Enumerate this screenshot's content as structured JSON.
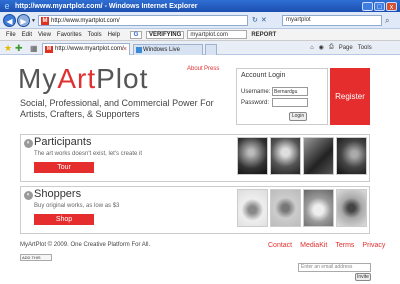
{
  "window": {
    "title": "http://www.myartplot.com/ - Windows Internet Explorer",
    "minimize": "_",
    "maximize": "□",
    "close": "x"
  },
  "addressbar": {
    "url": "http://www.myartplot.com/",
    "search_value": "myartplot"
  },
  "menubar": {
    "items": [
      "File",
      "Edit",
      "View",
      "Favorites",
      "Tools",
      "Help"
    ],
    "verifying_label": "VERIFYING",
    "verify_value": "myartplot.com",
    "report_label": "REPORT"
  },
  "tabs": [
    {
      "label": "http://www.myartplot.com/"
    },
    {
      "label": "Windows Live Hotmail"
    }
  ],
  "commandbar": {
    "page_label": "Page",
    "tools_label": "Tools"
  },
  "page": {
    "logo_my": "My",
    "logo_art": "Art",
    "logo_plot": "Plot",
    "nav": {
      "about": "About",
      "press": "Press"
    },
    "tagline": "Social, Professional, and Commercial Power For Artists, Crafters, & Supporters",
    "login": {
      "title": "Account Login",
      "username_label": "Username:",
      "username_value": "Bernardgu",
      "password_label": "Password:",
      "button": "Login"
    },
    "register": "Register",
    "participants": {
      "title": "Participants",
      "desc": "The art works doesn't exist, let's create it",
      "button": "Tour"
    },
    "shoppers": {
      "title": "Shoppers",
      "desc": "Buy original works, as low as $3",
      "button": "Shop"
    },
    "copyright": "MyArtPlot © 2009. One Creative Platform For All.",
    "footer_links": [
      "Contact",
      "MediaKit",
      "Terms",
      "Privacy"
    ],
    "addthis": "ADD THIS",
    "email_placeholder": "Enter an email address",
    "invite": "Invite"
  },
  "colors": {
    "accent_red": "#e52d2d",
    "ie_blue": "#2f6ed3"
  }
}
